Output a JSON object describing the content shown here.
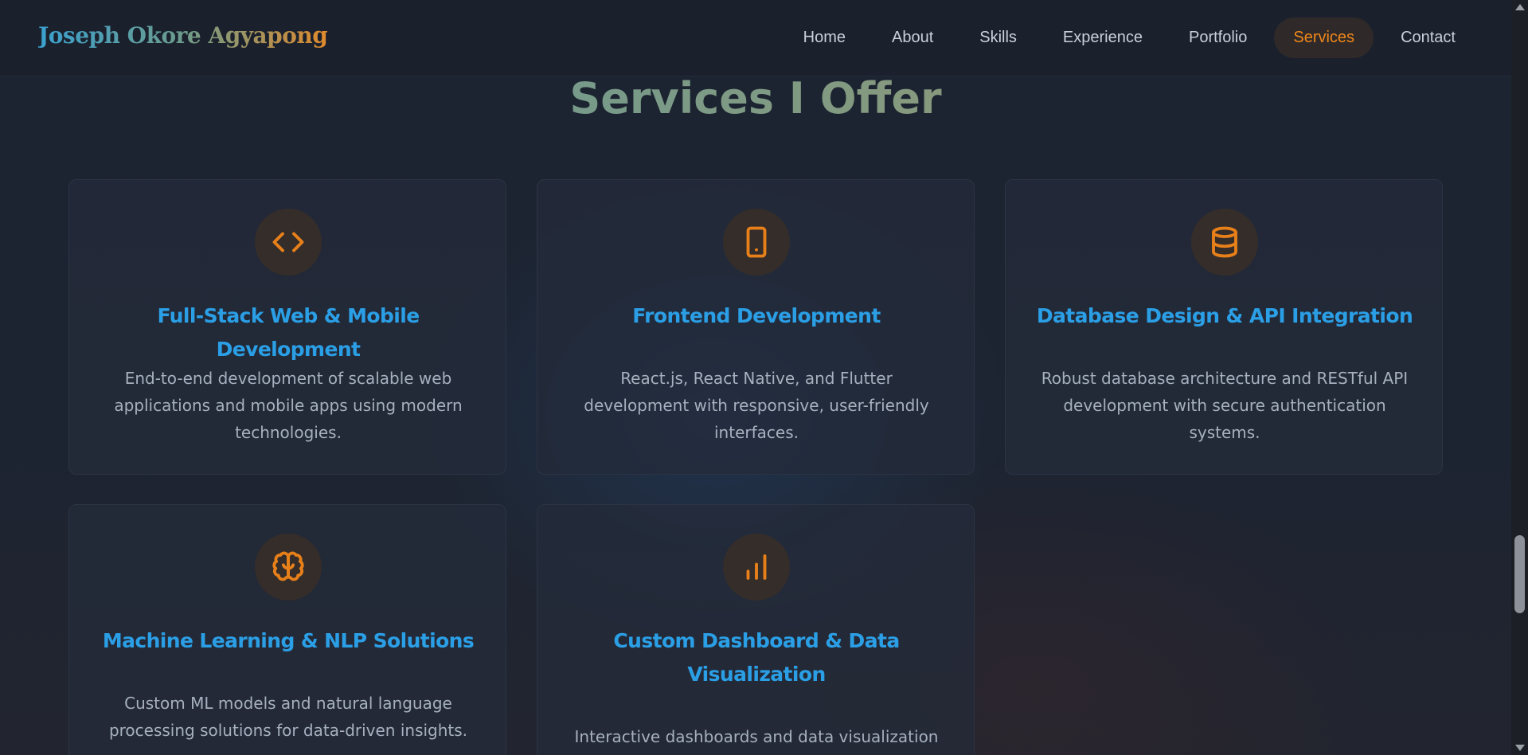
{
  "header": {
    "brand": "Joseph Okore Agyapong",
    "nav": [
      {
        "label": "Home"
      },
      {
        "label": "About"
      },
      {
        "label": "Skills"
      },
      {
        "label": "Experience"
      },
      {
        "label": "Portfolio"
      },
      {
        "label": "Services",
        "active": true
      },
      {
        "label": "Contact"
      }
    ]
  },
  "services": {
    "title": "Services I Offer",
    "cards": [
      {
        "icon": "code-icon",
        "title": "Full-Stack Web & Mobile Development",
        "desc": "End-to-end development of scalable web applications and mobile apps using modern technologies."
      },
      {
        "icon": "tablet-icon",
        "title": "Frontend Development",
        "desc": "React.js, React Native, and Flutter development with responsive, user-friendly interfaces."
      },
      {
        "icon": "database-icon",
        "title": "Database Design & API Integration",
        "desc": "Robust database architecture and RESTful API development with secure authentication systems."
      },
      {
        "icon": "brain-icon",
        "title": "Machine Learning & NLP Solutions",
        "desc": "Custom ML models and natural language processing solutions for data-driven insights."
      },
      {
        "icon": "bar-chart-icon",
        "title": "Custom Dashboard & Data Visualization",
        "desc": "Interactive dashboards and data visualization"
      }
    ]
  },
  "colors": {
    "accent": "#e8801a",
    "title_blue": "#2b9fe6",
    "background": "#1b2230"
  }
}
